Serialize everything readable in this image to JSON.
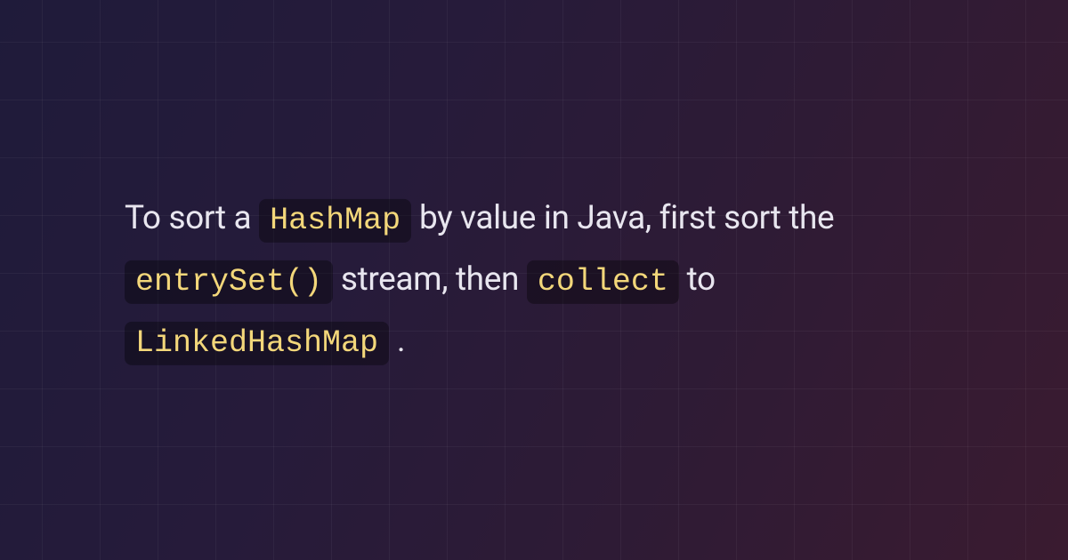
{
  "paragraph": {
    "segments": [
      {
        "text": "To sort a ",
        "code": false
      },
      {
        "text": "HashMap",
        "code": true
      },
      {
        "text": " by value in Java, first sort the ",
        "code": false
      },
      {
        "text": "entrySet()",
        "code": true
      },
      {
        "text": " stream, then ",
        "code": false
      },
      {
        "text": "collect",
        "code": true
      },
      {
        "text": " to ",
        "code": false
      },
      {
        "text": "LinkedHashMap",
        "code": true
      },
      {
        "text": ".",
        "code": false
      }
    ]
  },
  "colors": {
    "code_text": "#f3d77a",
    "body_text": "#e8e6ef",
    "code_bg": "rgba(0,0,0,0.35)"
  }
}
